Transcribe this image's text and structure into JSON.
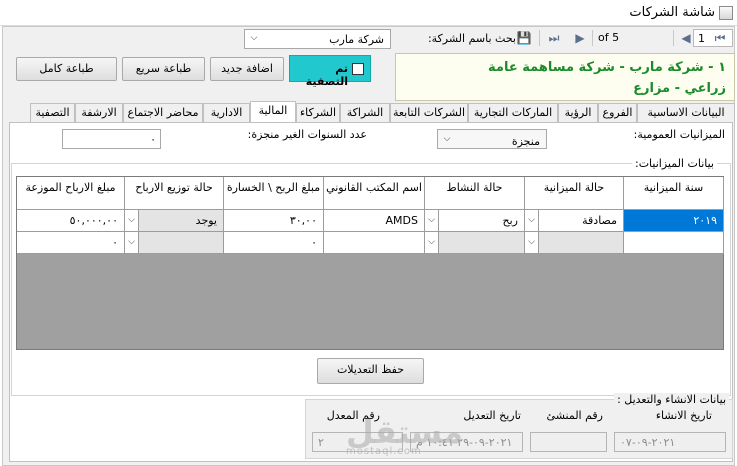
{
  "window": {
    "title": "شاشة الشركات"
  },
  "nav": {
    "position": "1",
    "of_label": "of 5"
  },
  "search": {
    "label": "بحث باسم الشركة:",
    "value": "شركة مارب"
  },
  "banner": {
    "line1": "١ - شركة مارب - شركة مساهمة عامة",
    "line2": "زراعي - مزارع"
  },
  "buttons": {
    "liquidation": "تم التصفية",
    "add_new": "اضافة جديد",
    "quick_print": "طباعة سريع",
    "full_print": "طباعة كامل",
    "save_changes": "حفظ التعديلات"
  },
  "tabs": [
    "البيانات الاساسية",
    "الفروع",
    "الرؤية",
    "الماركات التجارية",
    "الشركات التابعة",
    "الشراكة",
    "الشركاء",
    "المالية",
    "الادارية",
    "محاضر الاجتماع",
    "الارشفة",
    "التصفية"
  ],
  "general_budgets": {
    "label": "الميزانيات العمومية:",
    "value": "منجزة"
  },
  "incomplete_years": {
    "label": "عدد السنوات الغير منجزة:",
    "value": "٠"
  },
  "budgets_section": {
    "label": "بيانات الميزانيات:"
  },
  "grid": {
    "columns": [
      "سنة الميزانية",
      "حالة الميزانية",
      "حالة النشاط",
      "اسم المكتب القانوني",
      "مبلغ الربح \\ الخسارة",
      "حالة توزيع الارباح",
      "مبلغ الارباح الموزعة"
    ],
    "rows": [
      [
        "٢٠١٩",
        "مصادقة",
        "ربح",
        "AMDS",
        "٣٠,٠٠",
        "يوجد",
        "٥٠,٠٠٠,٠٠"
      ],
      [
        "",
        "",
        "",
        "",
        "٠",
        "",
        "٠"
      ]
    ]
  },
  "audit": {
    "label": "بيانات الانشاء والتعديل :",
    "created_date_label": "تاريخ الانشاء",
    "creator_label": "رقم المنشئ",
    "modified_date_label": "تاريخ التعديل",
    "modifier_label": "رقم المعدل",
    "created_date": "٢٠٢١-٠٩-٠٧",
    "creator": "",
    "modified_date": "٢٠٢١-٠٩-٢٩ ١٠:٤١ م",
    "modifier": "٢"
  },
  "watermark": {
    "text": "مستقل",
    "sub": "mostaql.com"
  },
  "colors": {
    "selected_cell": "#0078d7",
    "liquidation_box": "#21c9cf",
    "banner_text": "#1a8a2a",
    "grid_empty": "#a0a0a0"
  }
}
